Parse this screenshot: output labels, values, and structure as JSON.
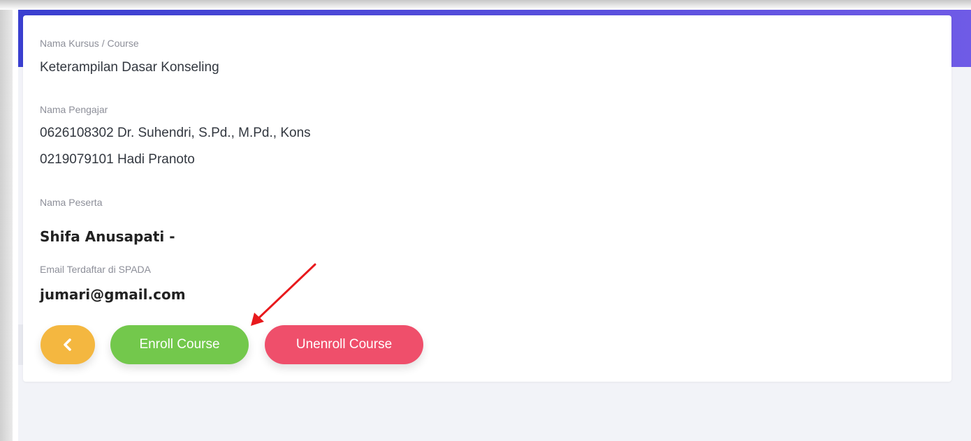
{
  "course": {
    "label": "Nama Kursus / Course",
    "value": "Keterampilan Dasar Konseling"
  },
  "teachers": {
    "label": "Nama Pengajar",
    "items": [
      "0626108302 Dr. Suhendri, S.Pd., M.Pd., Kons",
      "0219079101 Hadi Pranoto"
    ]
  },
  "participant": {
    "label": "Nama Peserta",
    "value": "Shifa Anusapati -"
  },
  "email": {
    "label": "Email Terdaftar di SPADA",
    "value": "jumari@gmail.com"
  },
  "actions": {
    "back_icon": "chevron-left-icon",
    "enroll_label": "Enroll Course",
    "unenroll_label": "Unenroll Course"
  },
  "colors": {
    "header_gradient_start": "#3a3fd0",
    "header_gradient_end": "#6f5be6",
    "back_button": "#f4b740",
    "enroll_button": "#73c84c",
    "unenroll_button": "#ef4f6b",
    "annotation_arrow": "#e8191c"
  }
}
